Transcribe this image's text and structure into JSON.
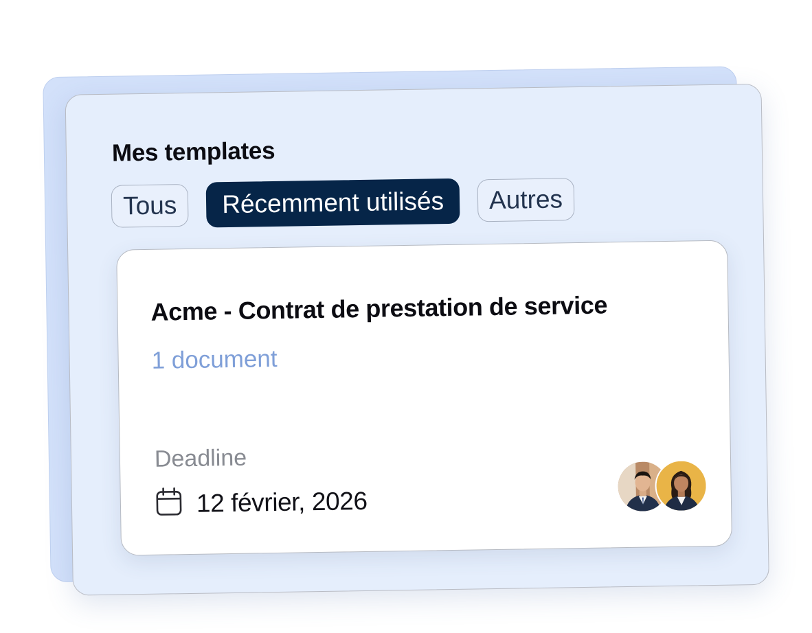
{
  "panel": {
    "title": "Mes templates"
  },
  "tabs": [
    {
      "label": "Tous",
      "active": false
    },
    {
      "label": "Récemment utilisés",
      "active": true
    },
    {
      "label": "Autres",
      "active": false
    }
  ],
  "card": {
    "title": "Acme - Contrat de prestation de service",
    "document_count": "1 document",
    "deadline_label": "Deadline",
    "deadline_date": "12 février, 2026",
    "date_icon": "calendar-icon",
    "avatars": [
      {
        "name": "man-in-suit-avatar",
        "bg": "#b98a66"
      },
      {
        "name": "woman-in-suit-avatar",
        "bg": "#e9b447"
      }
    ]
  },
  "colors": {
    "accent": "#062548",
    "link": "#7f9fd8",
    "panel_bg": "#e5eefc",
    "back_card": "#d3e1fa"
  }
}
